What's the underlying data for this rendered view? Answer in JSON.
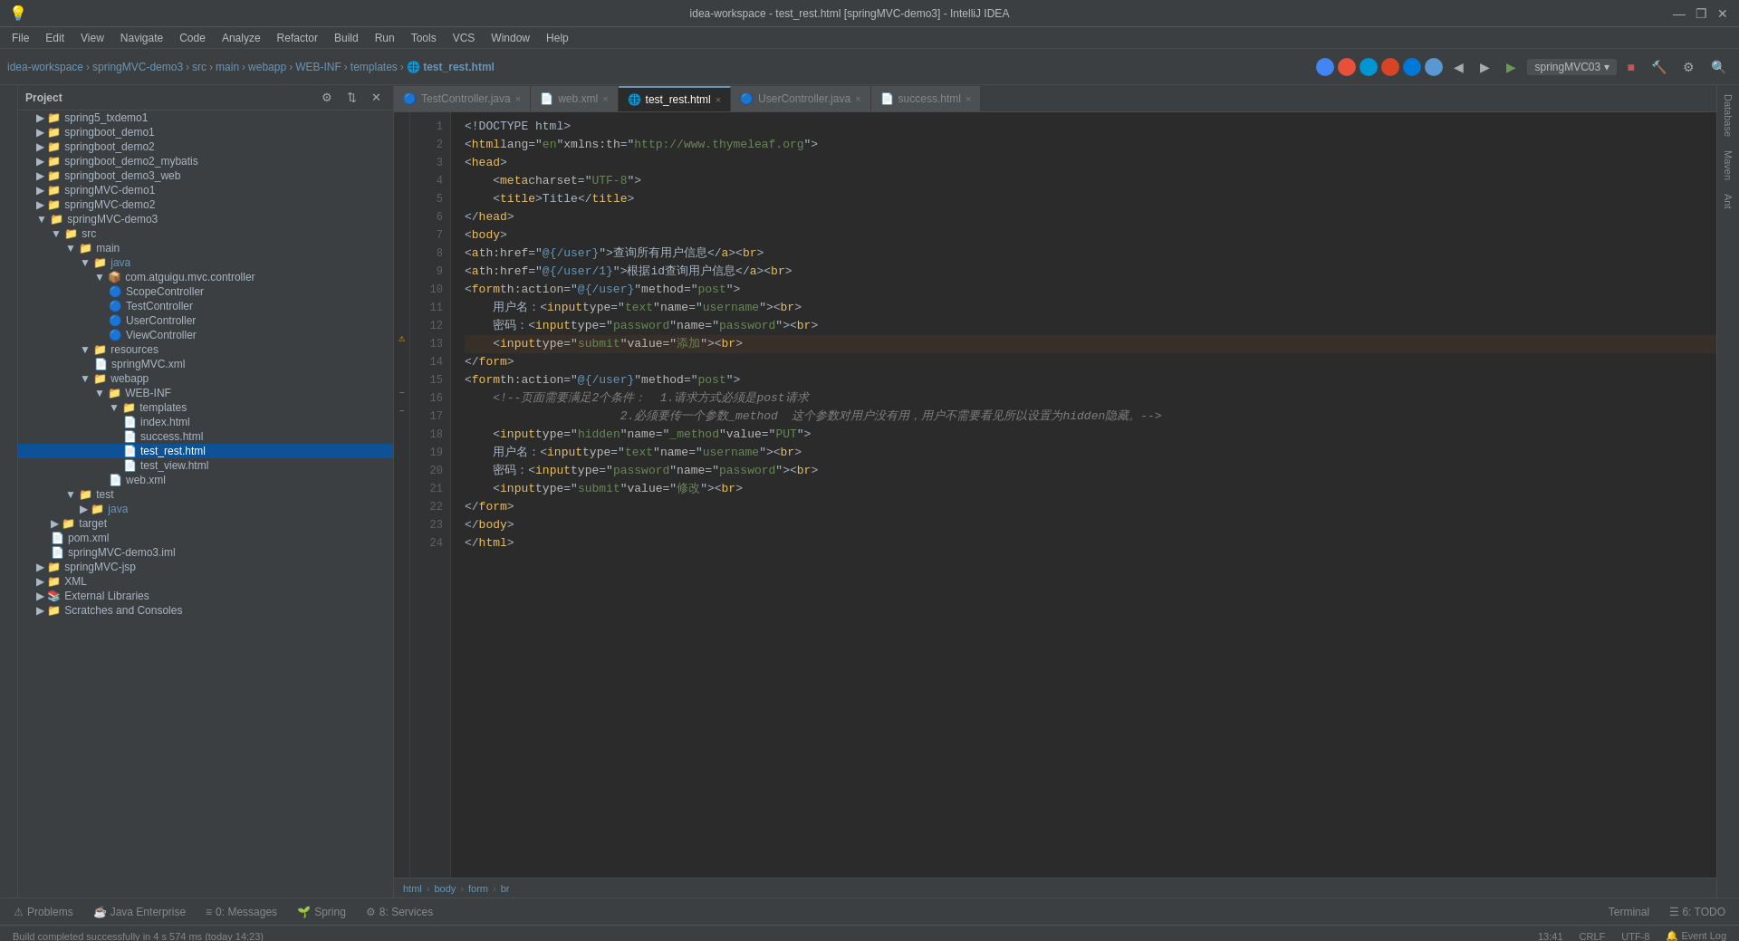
{
  "window": {
    "title": "idea-workspace - test_rest.html [springMVC-demo3] - IntelliJ IDEA",
    "controls": [
      "—",
      "❐",
      "✕"
    ]
  },
  "menubar": {
    "items": [
      "File",
      "Edit",
      "View",
      "Navigate",
      "Code",
      "Analyze",
      "Refactor",
      "Build",
      "Run",
      "Tools",
      "VCS",
      "Window",
      "Help"
    ]
  },
  "toolbar": {
    "breadcrumbs": [
      "idea-workspace",
      "springMVC-demo3",
      "src",
      "main",
      "webapp",
      "WEB-INF",
      "templates",
      "test_rest.html"
    ],
    "run_config": "springMVC03"
  },
  "sidebar": {
    "title": "Project",
    "tree": [
      {
        "level": 1,
        "icon": "📁",
        "label": "spring5_txdemo1",
        "type": "folder"
      },
      {
        "level": 1,
        "icon": "📁",
        "label": "springboot_demo1",
        "type": "folder"
      },
      {
        "level": 1,
        "icon": "📁",
        "label": "springboot_demo2",
        "type": "folder"
      },
      {
        "level": 1,
        "icon": "📁",
        "label": "springboot_demo2_mybatis",
        "type": "folder"
      },
      {
        "level": 1,
        "icon": "📁",
        "label": "springboot_demo3_web",
        "type": "folder"
      },
      {
        "level": 1,
        "icon": "📁",
        "label": "springMVC-demo1",
        "type": "folder"
      },
      {
        "level": 1,
        "icon": "📁",
        "label": "springMVC-demo2",
        "type": "folder"
      },
      {
        "level": 1,
        "icon": "📁",
        "label": "springMVC-demo3",
        "type": "folder",
        "expanded": true
      },
      {
        "level": 2,
        "icon": "📁",
        "label": "src",
        "type": "folder",
        "expanded": true
      },
      {
        "level": 3,
        "icon": "📁",
        "label": "main",
        "type": "folder",
        "expanded": true
      },
      {
        "level": 4,
        "icon": "📁",
        "label": "java",
        "type": "folder",
        "expanded": true
      },
      {
        "level": 5,
        "icon": "📦",
        "label": "com.atguigu.mvc.controller",
        "type": "package",
        "expanded": true
      },
      {
        "level": 6,
        "icon": "🔵",
        "label": "ScopeController",
        "type": "class"
      },
      {
        "level": 6,
        "icon": "🔵",
        "label": "TestController",
        "type": "class"
      },
      {
        "level": 6,
        "icon": "🔵",
        "label": "UserController",
        "type": "class"
      },
      {
        "level": 6,
        "icon": "🔵",
        "label": "ViewController",
        "type": "class"
      },
      {
        "level": 4,
        "icon": "📁",
        "label": "resources",
        "type": "folder",
        "expanded": true
      },
      {
        "level": 5,
        "icon": "📄",
        "label": "springMVC.xml",
        "type": "file"
      },
      {
        "level": 4,
        "icon": "📁",
        "label": "webapp",
        "type": "folder",
        "expanded": true
      },
      {
        "level": 5,
        "icon": "📁",
        "label": "WEB-INF",
        "type": "folder",
        "expanded": true
      },
      {
        "level": 6,
        "icon": "📁",
        "label": "templates",
        "type": "folder",
        "expanded": true
      },
      {
        "level": 7,
        "icon": "📄",
        "label": "index.html",
        "type": "file"
      },
      {
        "level": 7,
        "icon": "📄",
        "label": "success.html",
        "type": "file"
      },
      {
        "level": 7,
        "icon": "📄",
        "label": "test_rest.html",
        "type": "file",
        "selected": true
      },
      {
        "level": 7,
        "icon": "📄",
        "label": "test_view.html",
        "type": "file"
      },
      {
        "level": 6,
        "icon": "📄",
        "label": "web.xml",
        "type": "file"
      },
      {
        "level": 3,
        "icon": "📁",
        "label": "test",
        "type": "folder",
        "expanded": true
      },
      {
        "level": 4,
        "icon": "📁",
        "label": "java",
        "type": "folder"
      },
      {
        "level": 2,
        "icon": "📁",
        "label": "target",
        "type": "folder"
      },
      {
        "level": 2,
        "icon": "📄",
        "label": "pom.xml",
        "type": "file"
      },
      {
        "level": 2,
        "icon": "📄",
        "label": "springMVC-demo3.iml",
        "type": "file"
      },
      {
        "level": 1,
        "icon": "📁",
        "label": "springMVC-jsp",
        "type": "folder"
      },
      {
        "level": 1,
        "icon": "📁",
        "label": "XML",
        "type": "folder"
      },
      {
        "level": 1,
        "icon": "📚",
        "label": "External Libraries",
        "type": "folder"
      },
      {
        "level": 1,
        "icon": "📁",
        "label": "Scratches and Consoles",
        "type": "folder"
      }
    ]
  },
  "tabs": [
    {
      "label": "TestController.java",
      "icon": "🔵",
      "active": false
    },
    {
      "label": "web.xml",
      "icon": "📄",
      "active": false
    },
    {
      "label": "test_rest.html",
      "icon": "📄",
      "active": true
    },
    {
      "label": "UserController.java",
      "icon": "🔵",
      "active": false
    },
    {
      "label": "success.html",
      "icon": "📄",
      "active": false
    }
  ],
  "code": {
    "lines": [
      {
        "num": 1,
        "content": "<!DOCTYPE html>",
        "tokens": [
          {
            "t": "punct",
            "v": "<!DOCTYPE html>"
          }
        ]
      },
      {
        "num": 2,
        "content": "<html lang=\"en\" xmlns:th=\"http://www.thymeleaf.org\">",
        "tokens": []
      },
      {
        "num": 3,
        "content": "<head>",
        "tokens": []
      },
      {
        "num": 4,
        "content": "    <meta charset=\"UTF-8\">",
        "tokens": []
      },
      {
        "num": 5,
        "content": "    <title>Title</title>",
        "tokens": []
      },
      {
        "num": 6,
        "content": "</head>",
        "tokens": []
      },
      {
        "num": 7,
        "content": "<body>",
        "tokens": []
      },
      {
        "num": 8,
        "content": "<a th:href=\"@{/user}\">查询所有用户信息</a><br>",
        "tokens": []
      },
      {
        "num": 9,
        "content": "<a th:href=\"@{/user/1}\">根据id查询用户信息</a><br>",
        "tokens": []
      },
      {
        "num": 10,
        "content": "<form th:action=\"@{/user}\" method=\"post\">",
        "tokens": []
      },
      {
        "num": 11,
        "content": "    用户名：<input type=\"text\" name=\"username\"><br>",
        "tokens": []
      },
      {
        "num": 12,
        "content": "    密码：<input type=\"password\" name=\"password\"><br>",
        "tokens": []
      },
      {
        "num": 13,
        "content": "    <input type=\"submit\" value=\"添加\"><br>",
        "tokens": [],
        "warning": true
      },
      {
        "num": 14,
        "content": "</form>",
        "tokens": []
      },
      {
        "num": 15,
        "content": "<form th:action=\"@{/user}\" method=\"post\">",
        "tokens": []
      },
      {
        "num": 16,
        "content": "    <!--页面需要满足2个条件：  1.请求方式必须是post请求",
        "tokens": [],
        "fold": true
      },
      {
        "num": 17,
        "content": "                      2.必须要传一个参数_method  这个参数对用户没有用，用户不需要看见所以设置为hidden隐藏。-->",
        "tokens": [],
        "fold": true
      },
      {
        "num": 18,
        "content": "    <input type=\"hidden\" name=\"_method\" value=\"PUT\">",
        "tokens": []
      },
      {
        "num": 19,
        "content": "    用户名：<input type=\"text\" name=\"username\"><br>",
        "tokens": []
      },
      {
        "num": 20,
        "content": "    密码：<input type=\"password\" name=\"password\"><br>",
        "tokens": []
      },
      {
        "num": 21,
        "content": "    <input type=\"submit\" value=\"修改\"><br>",
        "tokens": []
      },
      {
        "num": 22,
        "content": "</form>",
        "tokens": []
      },
      {
        "num": 23,
        "content": "</body>",
        "tokens": []
      },
      {
        "num": 24,
        "content": "</html>",
        "tokens": []
      }
    ]
  },
  "status_breadcrumb": {
    "items": [
      "html",
      "body",
      "form",
      "br"
    ]
  },
  "statusbar": {
    "left": [
      "⚠ Problems",
      "☕ Java Enterprise",
      "≡ 0: Messages",
      "🌱 Spring",
      "⚙ 8: Services"
    ],
    "message": "Build completed successfully in 4 s 574 ms (today 14:23)",
    "right": [
      "Terminal",
      "☰ 6: TODO",
      "13:41",
      "CRLF",
      "UTF-8",
      "Event Log"
    ]
  },
  "bottom_tabs": {
    "items": [
      "⚠ Problems",
      "☕ Java Enterprise",
      "≡ 0: Messages",
      "🌱 Spring",
      "⚙ 8: Services"
    ]
  }
}
